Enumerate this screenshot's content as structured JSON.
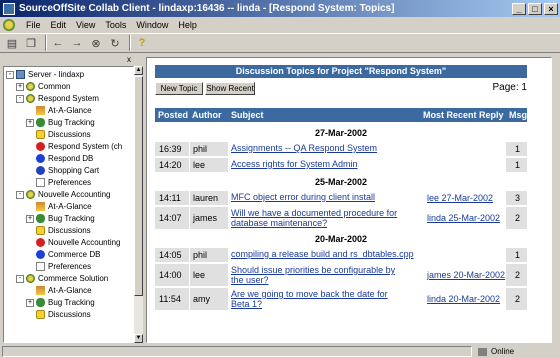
{
  "window": {
    "title": "SourceOffSite Collab Client - lindaxp:16436 -- linda - [Respond System: Topics]"
  },
  "menu": [
    "File",
    "Edit",
    "View",
    "Tools",
    "Window",
    "Help"
  ],
  "toolbar": {
    "icons": [
      "print-icon",
      "copy-icon",
      "back-icon",
      "forward-icon",
      "stop-icon",
      "refresh-icon",
      "help-icon"
    ],
    "help_glyph": "?"
  },
  "tree": {
    "close_glyph": "x",
    "items": [
      {
        "label": "Server - lindaxp",
        "icon": "server-icon",
        "exp": "-",
        "indent": 0
      },
      {
        "label": "Common",
        "icon": "project-icon",
        "exp": "+",
        "indent": 1
      },
      {
        "label": "Respond System",
        "icon": "project-icon",
        "exp": "-",
        "indent": 1
      },
      {
        "label": "At-A-Glance",
        "icon": "home-icon",
        "exp": "",
        "indent": 2
      },
      {
        "label": "Bug Tracking",
        "icon": "bug-icon",
        "exp": "+",
        "indent": 2
      },
      {
        "label": "Discussions",
        "icon": "discussion-icon",
        "exp": "",
        "indent": 2
      },
      {
        "label": "Respond System (ch",
        "icon": "respond-icon",
        "exp": "",
        "indent": 2
      },
      {
        "label": "Respond DB",
        "icon": "database-icon",
        "exp": "",
        "indent": 2
      },
      {
        "label": "Shopping Cart",
        "icon": "cart-icon",
        "exp": "",
        "indent": 2
      },
      {
        "label": "Preferences",
        "icon": "preferences-icon",
        "exp": "",
        "indent": 2
      },
      {
        "label": "Nouvelle Accounting",
        "icon": "project-icon",
        "exp": "-",
        "indent": 1
      },
      {
        "label": "At-A-Glance",
        "icon": "home-icon",
        "exp": "",
        "indent": 2
      },
      {
        "label": "Bug Tracking",
        "icon": "bug-icon",
        "exp": "+",
        "indent": 2
      },
      {
        "label": "Discussions",
        "icon": "discussion-icon",
        "exp": "",
        "indent": 2
      },
      {
        "label": "Nouvelle Accounting",
        "icon": "respond-icon",
        "exp": "",
        "indent": 2
      },
      {
        "label": "Commerce DB",
        "icon": "database-icon",
        "exp": "",
        "indent": 2
      },
      {
        "label": "Preferences",
        "icon": "preferences-icon",
        "exp": "",
        "indent": 2
      },
      {
        "label": "Commerce Solution",
        "icon": "project-icon",
        "exp": "-",
        "indent": 1
      },
      {
        "label": "At-A-Glance",
        "icon": "home-icon",
        "exp": "",
        "indent": 2
      },
      {
        "label": "Bug Tracking",
        "icon": "bug-icon",
        "exp": "+",
        "indent": 2
      },
      {
        "label": "Discussions",
        "icon": "discussion-icon",
        "exp": "",
        "indent": 2
      }
    ]
  },
  "main": {
    "banner": "Discussion Topics for Project \"Respond System\"",
    "new_topic": "New Topic",
    "show_recent": "Show Recent",
    "page_label": "Page: 1",
    "columns": {
      "posted": "Posted",
      "author": "Author",
      "subject": "Subject",
      "recent": "Most Recent Reply",
      "msgs": "Msgs"
    },
    "groups": [
      {
        "date": "27-Mar-2002",
        "rows": [
          {
            "time": "16:39",
            "author": "phil",
            "subject": [
              "Assignments -- QA Respond System"
            ],
            "reply": "",
            "msgs": "1"
          },
          {
            "time": "14:20",
            "author": "lee",
            "subject": [
              "Access rights for System Admin"
            ],
            "reply": "",
            "msgs": "1"
          }
        ]
      },
      {
        "date": "25-Mar-2002",
        "rows": [
          {
            "time": "14:11",
            "author": "lauren",
            "subject": [
              "MFC object error during client install"
            ],
            "reply": "lee 27-Mar-2002",
            "msgs": "3"
          },
          {
            "time": "14:07",
            "author": "james",
            "subject": [
              "Will we have a documented procedure for",
              "database maintenance?"
            ],
            "reply": "linda 25-Mar-2002",
            "msgs": "2"
          }
        ]
      },
      {
        "date": "20-Mar-2002",
        "rows": [
          {
            "time": "14:05",
            "author": "phil",
            "subject": [
              "compiling a release build and rs_dbtables.cpp"
            ],
            "reply": "",
            "msgs": "1"
          },
          {
            "time": "14:00",
            "author": "lee",
            "subject": [
              "Should issue priorities be configurable by",
              "the user?"
            ],
            "reply": "james 20-Mar-2002",
            "msgs": "2"
          },
          {
            "time": "11:54",
            "author": "amy",
            "subject": [
              "Are we going to move back the date for",
              "Beta 1?"
            ],
            "reply": "linda 20-Mar-2002",
            "msgs": "2"
          }
        ]
      }
    ]
  },
  "status": {
    "online": "Online"
  }
}
